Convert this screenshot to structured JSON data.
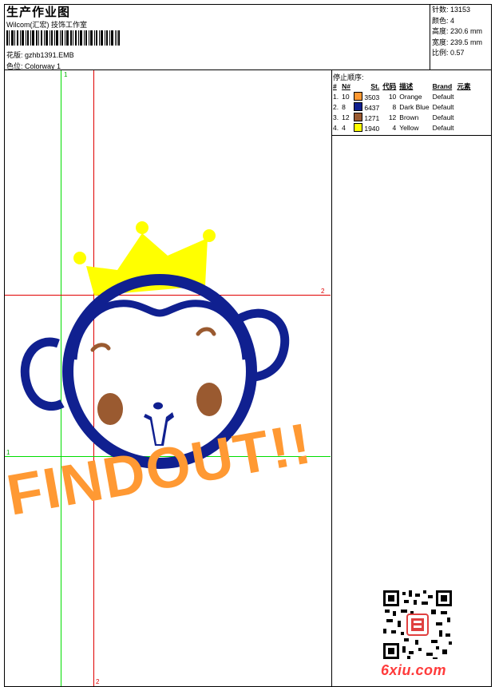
{
  "header": {
    "title": "生产作业图",
    "studio": "Wilcom(汇宏) 技饰工作室",
    "design_label": "花版:",
    "design_file": "gzhb1391.EMB",
    "colorway_label": "色位:",
    "colorway": "Colorway 1"
  },
  "stats": [
    {
      "label": "针数:",
      "value": "13153"
    },
    {
      "label": "颜色:",
      "value": "4"
    },
    {
      "label": "高度:",
      "value": "230.6 mm"
    },
    {
      "label": "宽度:",
      "value": "239.5 mm"
    },
    {
      "label": "比例:",
      "value": "0.57"
    }
  ],
  "stop_sequence": {
    "title": "停止顺序:",
    "headers": [
      "#",
      "N#",
      "St.",
      "代码",
      "描述",
      "Brand",
      "元素"
    ],
    "rows": [
      {
        "idx": "1.",
        "n": "10",
        "color": "#ff9933",
        "st": "3503",
        "code": "10",
        "desc": "Orange",
        "brand": "Default"
      },
      {
        "idx": "2.",
        "n": "8",
        "color": "#102090",
        "st": "6437",
        "code": "8",
        "desc": "Dark Blue",
        "brand": "Default"
      },
      {
        "idx": "3.",
        "n": "12",
        "color": "#9a5a30",
        "st": "1271",
        "code": "12",
        "desc": "Brown",
        "brand": "Default"
      },
      {
        "idx": "4.",
        "n": "4",
        "color": "#ffff00",
        "st": "1940",
        "code": "4",
        "desc": "Yellow",
        "brand": "Default"
      }
    ]
  },
  "design": {
    "text": "FINDOUT!!",
    "guide_labels": {
      "v1": "1",
      "h2": "2",
      "h1": "1",
      "v2": "2"
    }
  },
  "watermark": {
    "text": "6xiu.com"
  }
}
